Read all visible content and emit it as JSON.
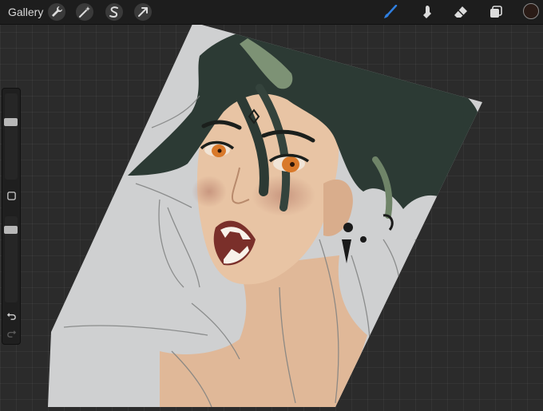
{
  "toolbar": {
    "gallery_label": "Gallery",
    "left_tools": [
      {
        "name": "actions",
        "icon": "wrench-icon"
      },
      {
        "name": "adjustments",
        "icon": "magic-wand-icon"
      },
      {
        "name": "selection",
        "icon": "selection-s-icon"
      },
      {
        "name": "transform",
        "icon": "arrow-cursor-icon"
      }
    ],
    "right_tools": [
      {
        "name": "brush",
        "icon": "brush-icon",
        "active": true
      },
      {
        "name": "smudge",
        "icon": "smudge-finger-icon",
        "active": false
      },
      {
        "name": "eraser",
        "icon": "eraser-icon",
        "active": false
      },
      {
        "name": "layers",
        "icon": "layers-icon",
        "active": false
      }
    ],
    "current_color": "#2a1b16"
  },
  "sidebar": {
    "brush_size_level": 0.32,
    "opacity_level": 0.12,
    "modify_button_icon": "square-icon",
    "undo_icon": "undo-icon",
    "redo_icon": "redo-icon"
  },
  "canvas": {
    "paper_color": "#cfd0d1",
    "skin_color": "#e0b898",
    "hair_color": "#2c3a34",
    "hair_highlight": "#7d9275",
    "eye_color": "#d9792a",
    "accent_color": "#2f7fe0"
  }
}
